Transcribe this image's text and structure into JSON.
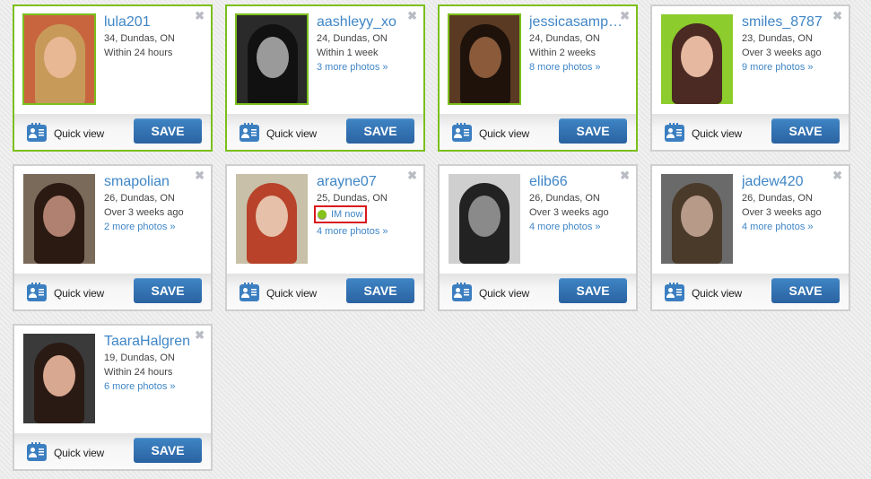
{
  "common": {
    "quick_view_label": "Quick view",
    "save_label": "SAVE",
    "close_symbol": "✖"
  },
  "profiles": [
    {
      "username": "lula201",
      "details": "34, Dundas, ON",
      "activity": "Within 24 hours",
      "photos_link": "",
      "highlighted": true,
      "im_now": false,
      "photo_colors": {
        "bg": "#c8653f",
        "hair": "#c89a5a",
        "face": "#e8b894"
      }
    },
    {
      "username": "aashleyy_xo",
      "details": "24, Dundas, ON",
      "activity": "Within 1 week",
      "photos_link": "3 more photos »",
      "highlighted": true,
      "im_now": false,
      "photo_colors": {
        "bg": "#2a2a2a",
        "hair": "#111111",
        "face": "#9a9a9a"
      }
    },
    {
      "username": "jessicasamp…",
      "details": "24, Dundas, ON",
      "activity": "Within 2 weeks",
      "photos_link": "8 more photos »",
      "highlighted": true,
      "im_now": false,
      "photo_colors": {
        "bg": "#5a3a22",
        "hair": "#1e120b",
        "face": "#8a5a3a"
      }
    },
    {
      "username": "smiles_8787",
      "details": "23, Dundas, ON",
      "activity": "Over 3 weeks ago",
      "photos_link": "9 more photos »",
      "highlighted": false,
      "im_now": false,
      "photo_colors": {
        "bg": "#8ccc2c",
        "hair": "#4a2a22",
        "face": "#e6b8a0"
      }
    },
    {
      "username": "smapolian",
      "details": "26, Dundas, ON",
      "activity": "Over 3 weeks ago",
      "photos_link": "2 more photos »",
      "highlighted": false,
      "im_now": false,
      "photo_colors": {
        "bg": "#7a6a5a",
        "hair": "#2a1a12",
        "face": "#b08070"
      }
    },
    {
      "username": "arayne07",
      "details": "25, Dundas, ON",
      "activity": "",
      "im_label": "IM now",
      "photos_link": "4 more photos »",
      "highlighted": false,
      "im_now": true,
      "photo_colors": {
        "bg": "#c8c0a8",
        "hair": "#b8422a",
        "face": "#e6c0a8"
      }
    },
    {
      "username": "elib66",
      "details": "26, Dundas, ON",
      "activity": "Over 3 weeks ago",
      "photos_link": "4 more photos »",
      "highlighted": false,
      "im_now": false,
      "photo_colors": {
        "bg": "#cfcfcf",
        "hair": "#222222",
        "face": "#8a8a8a"
      }
    },
    {
      "username": "jadew420",
      "details": "26, Dundas, ON",
      "activity": "Over 3 weeks ago",
      "photos_link": "4 more photos »",
      "highlighted": false,
      "im_now": false,
      "photo_colors": {
        "bg": "#6a6a6a",
        "hair": "#4a3a2a",
        "face": "#b89a88"
      }
    },
    {
      "username": "TaaraHalgren",
      "details": "19, Dundas, ON",
      "activity": "Within 24 hours",
      "photos_link": "6 more photos »",
      "highlighted": false,
      "im_now": false,
      "photo_colors": {
        "bg": "#3a3a3a",
        "hair": "#2a1a14",
        "face": "#d8a890"
      }
    }
  ]
}
